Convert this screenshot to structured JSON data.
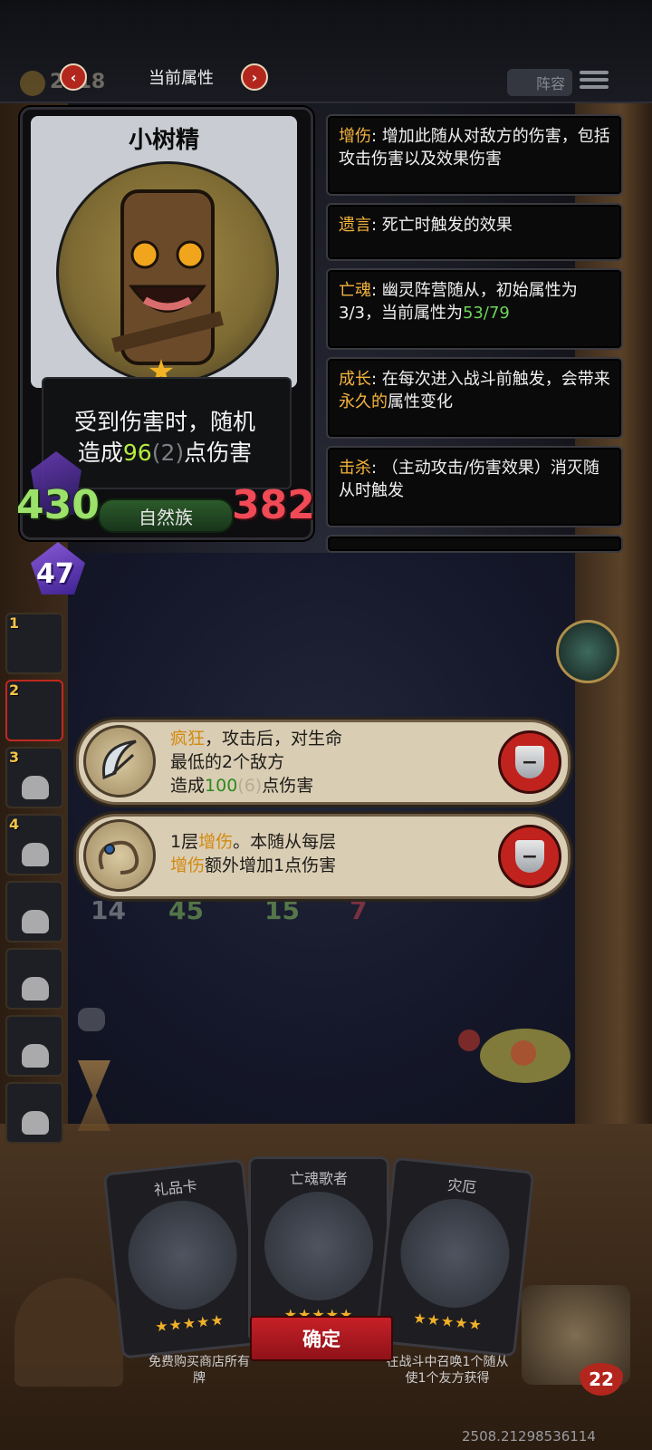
{
  "header": {
    "title": "当前属性",
    "coins": "2318",
    "lineup_label": "阵容"
  },
  "card": {
    "name": "小树精",
    "desc_line1": "受到伤害时，随机",
    "desc_line2_pre": "造成",
    "desc_dmg": "96",
    "desc_dmg_extra": "(2)",
    "desc_line2_post": "点伤害",
    "attack": "430",
    "health": "382",
    "tribe": "自然族",
    "buff_value": "47",
    "stars": 1
  },
  "keywords": [
    {
      "key": "增伤",
      "text": ": 增加此随从对敌方的伤害，包括攻击伤害以及效果伤害"
    },
    {
      "key": "遗言",
      "text": ": 死亡时触发的效果"
    },
    {
      "key": "亡魂",
      "text": ": 幽灵阵营随从，初始属性为3/3，当前属性为",
      "value": "53/79"
    },
    {
      "key": "成长",
      "text_pre": ": 在每次进入战斗前触发，会带来",
      "highlight": "永久的",
      "text_post": "属性变化"
    },
    {
      "key": "击杀",
      "text": ": （主动攻击/伤害效果）消灭随从时触发"
    }
  ],
  "slots": [
    "1",
    "2",
    "3",
    "4",
    "",
    "",
    "",
    ""
  ],
  "skills": [
    {
      "line1_key": "疯狂",
      "line1": "，攻击后，对生命",
      "line2": "最低的2个敌方",
      "line3_pre": "造成",
      "line3_val": "100",
      "line3_extra": "(6)",
      "line3_post": "点伤害"
    },
    {
      "line1_pre": "1层",
      "line1_key": "增伤",
      "line1_post": "。本随从每层",
      "line2_key": "增伤",
      "line2": "额外增加1点伤害"
    }
  ],
  "ghost_stats": {
    "a1": "14",
    "a2": "45",
    "b1": "15",
    "b2": "7"
  },
  "bottom_cards": [
    {
      "name": "礼品卡",
      "text": "免费购买商店所有牌"
    },
    {
      "name": "亡魂歌者",
      "text": ""
    },
    {
      "name": "灾厄",
      "text": "在战斗中召唤1个随从使1个友方获得"
    }
  ],
  "confirm_label": "确定",
  "hero_hp": "22",
  "version": "2508.21298536114",
  "colors": {
    "keyword": "#f5b33d",
    "stat_green": "#9be16a",
    "stat_red": "#f04a57",
    "confirm": "#c62028"
  }
}
